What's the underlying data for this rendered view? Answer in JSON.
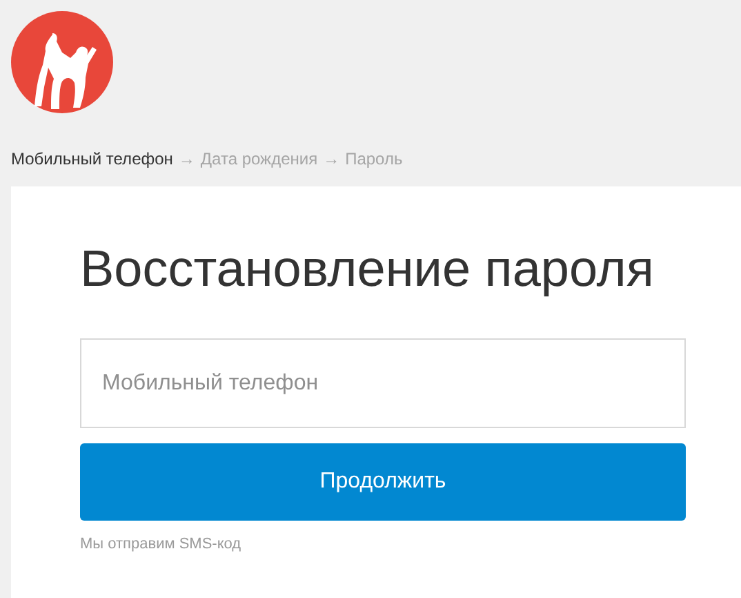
{
  "breadcrumb": [
    {
      "label": "Мобильный телефон",
      "selected": true
    },
    {
      "separator": "→",
      "label": "Дата рождения",
      "selected": false
    },
    {
      "separator": "→",
      "label": "Пароль",
      "selected": false
    }
  ],
  "title": "Восстановление пароля",
  "phone_field": {
    "placeholder": "Мобильный телефон"
  },
  "continue_button": "Продолжить",
  "hint": "Мы отправим SMS-код"
}
